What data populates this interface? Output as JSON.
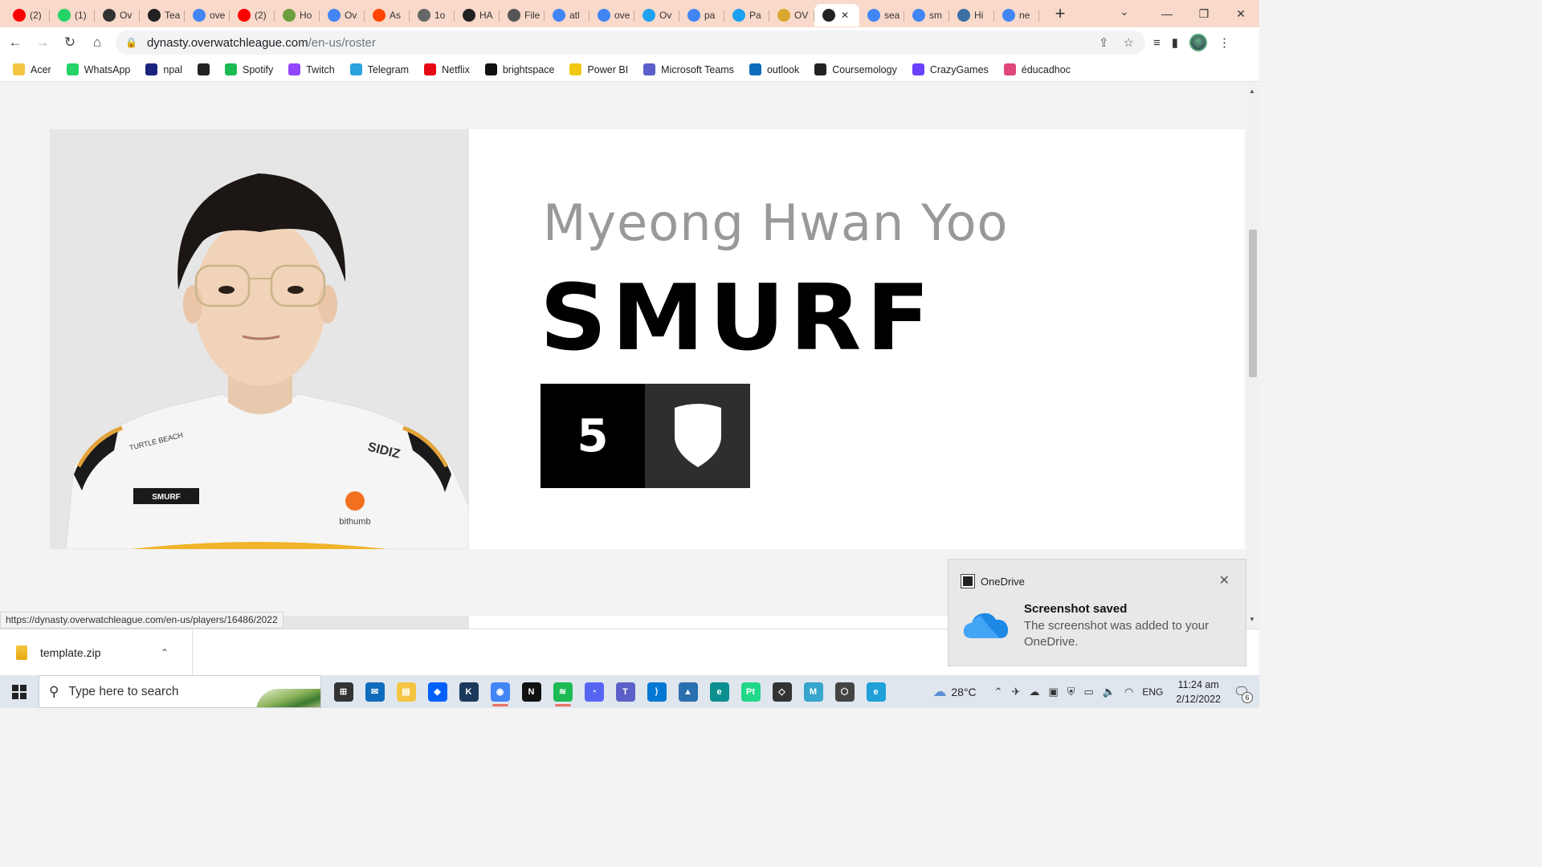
{
  "tabs": [
    {
      "title": "(2)",
      "icon": "youtube-icon",
      "color": "#ff0000"
    },
    {
      "title": "(1)",
      "icon": "whatsapp-icon",
      "color": "#25d366"
    },
    {
      "title": "Ov",
      "icon": "overwatch-icon",
      "color": "#333333"
    },
    {
      "title": "Tea",
      "icon": "dynasty-icon",
      "color": "#222222"
    },
    {
      "title": "ove",
      "icon": "google-icon",
      "color": "#4285f4"
    },
    {
      "title": "(2)",
      "icon": "youtube-icon",
      "color": "#ff0000"
    },
    {
      "title": "Ho",
      "icon": "wikihow-icon",
      "color": "#6b9e3f"
    },
    {
      "title": "Ov",
      "icon": "google-icon",
      "color": "#4285f4"
    },
    {
      "title": "As",
      "icon": "reddit-icon",
      "color": "#ff4500"
    },
    {
      "title": "1o",
      "icon": "globe-icon",
      "color": "#666666"
    },
    {
      "title": "HA",
      "icon": "dynasty-icon",
      "color": "#222222"
    },
    {
      "title": "File",
      "icon": "wiki-icon",
      "color": "#555555"
    },
    {
      "title": "atl",
      "icon": "google-icon",
      "color": "#4285f4"
    },
    {
      "title": "ove",
      "icon": "google-icon",
      "color": "#4285f4"
    },
    {
      "title": "Ov",
      "icon": "twitter-icon",
      "color": "#1da1f2"
    },
    {
      "title": "pa",
      "icon": "google-icon",
      "color": "#4285f4"
    },
    {
      "title": "Pa",
      "icon": "twitter-icon",
      "color": "#1da1f2"
    },
    {
      "title": "OV",
      "icon": "liquipedia-icon",
      "color": "#d9a62e"
    },
    {
      "title": "",
      "icon": "dynasty-icon",
      "color": "#222222",
      "active": true
    },
    {
      "title": "sea",
      "icon": "google-icon",
      "color": "#4285f4"
    },
    {
      "title": "sm",
      "icon": "google-icon",
      "color": "#4285f4"
    },
    {
      "title": "Hi",
      "icon": "globe-icon",
      "color": "#3a6ea5"
    },
    {
      "title": "ne",
      "icon": "google-icon",
      "color": "#4285f4"
    }
  ],
  "toolbar": {
    "url_host": "dynasty.overwatchleague.com",
    "url_path": "/en-us/roster"
  },
  "bookmarks": [
    {
      "label": "Acer",
      "icon": "folder-icon",
      "color": "#f4c542"
    },
    {
      "label": "WhatsApp",
      "icon": "whatsapp-icon",
      "color": "#25d366"
    },
    {
      "label": "npal",
      "icon": "npal-icon",
      "color": "#1a237e"
    },
    {
      "label": "",
      "icon": "globe-icon",
      "color": "#222222"
    },
    {
      "label": "Spotify",
      "icon": "spotify-icon",
      "color": "#1db954"
    },
    {
      "label": "Twitch",
      "icon": "twitch-icon",
      "color": "#9146ff"
    },
    {
      "label": "Telegram",
      "icon": "telegram-icon",
      "color": "#2aa3df"
    },
    {
      "label": "Netflix",
      "icon": "netflix-icon",
      "color": "#e50914"
    },
    {
      "label": "brightspace",
      "icon": "np-icon",
      "color": "#111111"
    },
    {
      "label": "Power BI",
      "icon": "powerbi-icon",
      "color": "#f2c811"
    },
    {
      "label": "Microsoft Teams",
      "icon": "teams-icon",
      "color": "#5b5fc7"
    },
    {
      "label": "outlook",
      "icon": "outlook-icon",
      "color": "#0f6cbd"
    },
    {
      "label": "Coursemology",
      "icon": "coursemology-icon",
      "color": "#222222"
    },
    {
      "label": "CrazyGames",
      "icon": "crazygames-icon",
      "color": "#6842ff"
    },
    {
      "label": "éducadhoc",
      "icon": "educadhoc-icon",
      "color": "#e0457b"
    }
  ],
  "player": {
    "full_name": "Myeong Hwan Yoo",
    "handle": "SMURF",
    "number": "5",
    "role_icon": "tank-shield-icon",
    "jersey_name": "SMURF",
    "sponsor_left": "TURTLE BEACH",
    "sponsor_right": "SIDIZ",
    "sponsor_chest": "bithumb"
  },
  "status_url": "https://dynasty.overwatchleague.com/en-us/players/16486/2022",
  "download": {
    "filename": "template.zip"
  },
  "toast": {
    "app": "OneDrive",
    "title": "Screenshot saved",
    "body": "The screenshot was added to your OneDrive."
  },
  "taskbar": {
    "search_placeholder": "Type here to search",
    "apps": [
      {
        "name": "task-view-icon",
        "color": "#333333",
        "glyph": "⊞"
      },
      {
        "name": "mail-icon",
        "color": "#0f6cbd",
        "glyph": "✉"
      },
      {
        "name": "file-explorer-icon",
        "color": "#f4c542",
        "glyph": "▤"
      },
      {
        "name": "dropbox-icon",
        "color": "#0061fe",
        "glyph": "◆"
      },
      {
        "name": "kindle-icon",
        "color": "#1a3a5c",
        "glyph": "K"
      },
      {
        "name": "chrome-icon",
        "color": "#4285f4",
        "glyph": "◉",
        "running": true
      },
      {
        "name": "netflix-icon",
        "color": "#111111",
        "glyph": "N"
      },
      {
        "name": "spotify-icon",
        "color": "#1db954",
        "glyph": "≋",
        "running": true
      },
      {
        "name": "discord-icon",
        "color": "#5865f2",
        "glyph": "◔"
      },
      {
        "name": "teams-icon",
        "color": "#5b5fc7",
        "glyph": "T"
      },
      {
        "name": "vscode-icon",
        "color": "#0078d4",
        "glyph": "⟩"
      },
      {
        "name": "photos-icon",
        "color": "#2a6fb0",
        "glyph": "▲"
      },
      {
        "name": "edge-icon",
        "color": "#0c8f8f",
        "glyph": "e"
      },
      {
        "name": "pycharm-icon",
        "color": "#21d789",
        "glyph": "Pt"
      },
      {
        "name": "unity-icon",
        "color": "#333333",
        "glyph": "◇"
      },
      {
        "name": "maya-icon",
        "color": "#37a5cc",
        "glyph": "M"
      },
      {
        "name": "unity-hub-icon",
        "color": "#444444",
        "glyph": "⬡"
      },
      {
        "name": "edge-dev-icon",
        "color": "#1fa0d8",
        "glyph": "e"
      }
    ],
    "temperature": "28°C",
    "language": "ENG",
    "time": "11:24 am",
    "date": "2/12/2022",
    "notifications": "6"
  }
}
